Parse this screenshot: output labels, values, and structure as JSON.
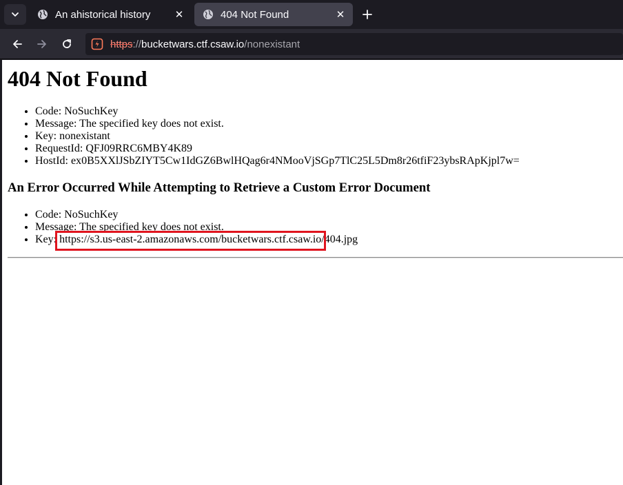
{
  "tabs": [
    {
      "label": "An ahistorical history",
      "active": false
    },
    {
      "label": "404 Not Found",
      "active": true
    }
  ],
  "urlbar": {
    "scheme": "https",
    "separator": "://",
    "host": "bucketwars.ctf.csaw.io",
    "path": "/nonexistant"
  },
  "page": {
    "title": "404 Not Found",
    "details": [
      "Code: NoSuchKey",
      "Message: The specified key does not exist.",
      "Key: nonexistant",
      "RequestId: QFJ09RRC6MBY4K89",
      "HostId: ex0B5XXlJSbZIYT5Cw1IdGZ6BwlHQag6r4NMooVjSGp7TlC25L5Dm8r26tfiF23ybsRApKjpl7w="
    ],
    "error_heading": "An Error Occurred While Attempting to Retrieve a Custom Error Document",
    "error_details": [
      "Code: NoSuchKey",
      "Message: The specified key does not exist.",
      "Key: https://s3.us-east-2.amazonaws.com/bucketwars.ctf.csaw.io/404.jpg"
    ]
  },
  "colors": {
    "annotation_box": "#e0141e",
    "tab_active": "#42414d",
    "toolbar": "#2b2a33"
  }
}
